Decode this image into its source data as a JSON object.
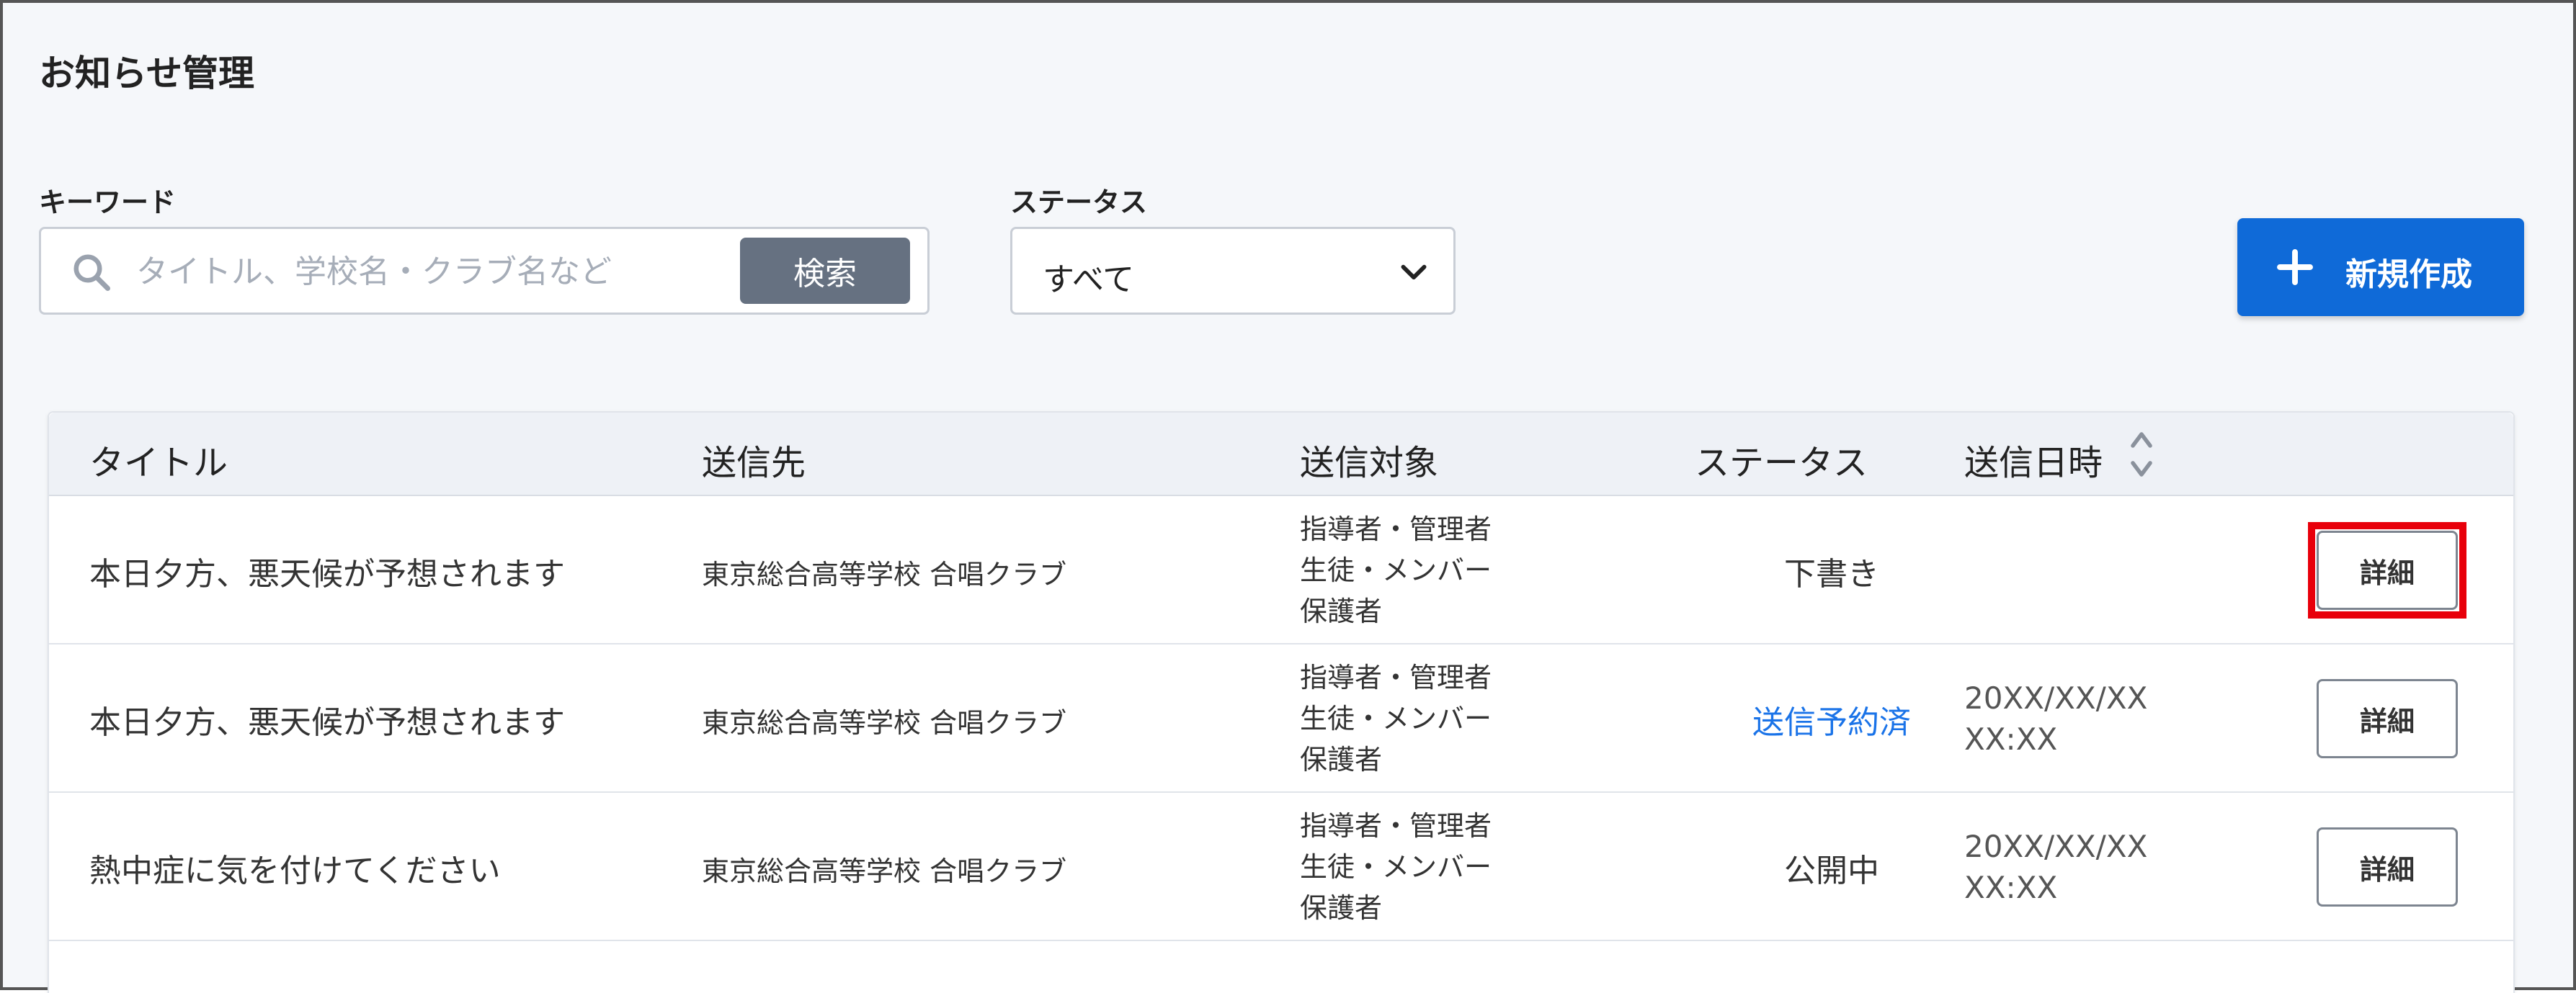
{
  "page": {
    "title": "お知らせ管理"
  },
  "search": {
    "label": "キーワード",
    "placeholder": "タイトル、学校名・クラブ名など",
    "button_label": "検索",
    "icon": "search-icon"
  },
  "status_filter": {
    "label": "ステータス",
    "selected": "すべて",
    "icon": "chevron-down-icon"
  },
  "new_button": {
    "label": "新規作成",
    "icon": "plus-icon"
  },
  "table": {
    "columns": [
      "タイトル",
      "送信先",
      "送信対象",
      "ステータス",
      "送信日時"
    ],
    "sortable_column": "送信日時",
    "rows": [
      {
        "title": "本日夕方、悪天候が予想されます",
        "destination": "東京総合高等学校 合唱クラブ",
        "targets": [
          "指導者・管理者",
          "生徒・メンバー",
          "保護者"
        ],
        "status": "下書き",
        "date_line1": "",
        "date_line2": "",
        "detail_label": "詳細",
        "highlighted": true
      },
      {
        "title": "本日夕方、悪天候が予想されます",
        "destination": "東京総合高等学校 合唱クラブ",
        "targets": [
          "指導者・管理者",
          "生徒・メンバー",
          "保護者"
        ],
        "status": "送信予約済",
        "date_line1": "20XX/XX/XX",
        "date_line2": "XX:XX",
        "detail_label": "詳細",
        "highlighted": false
      },
      {
        "title": "熱中症に気を付けてください",
        "destination": "東京総合高等学校 合唱クラブ",
        "targets": [
          "指導者・管理者",
          "生徒・メンバー",
          "保護者"
        ],
        "status": "公開中",
        "date_line1": "20XX/XX/XX",
        "date_line2": "XX:XX",
        "detail_label": "詳細",
        "highlighted": false
      }
    ]
  },
  "colors": {
    "primary": "#0f6ad8",
    "search_button": "#667181",
    "scheduled_status": "#1a73e8",
    "highlight": "#e8000b"
  }
}
